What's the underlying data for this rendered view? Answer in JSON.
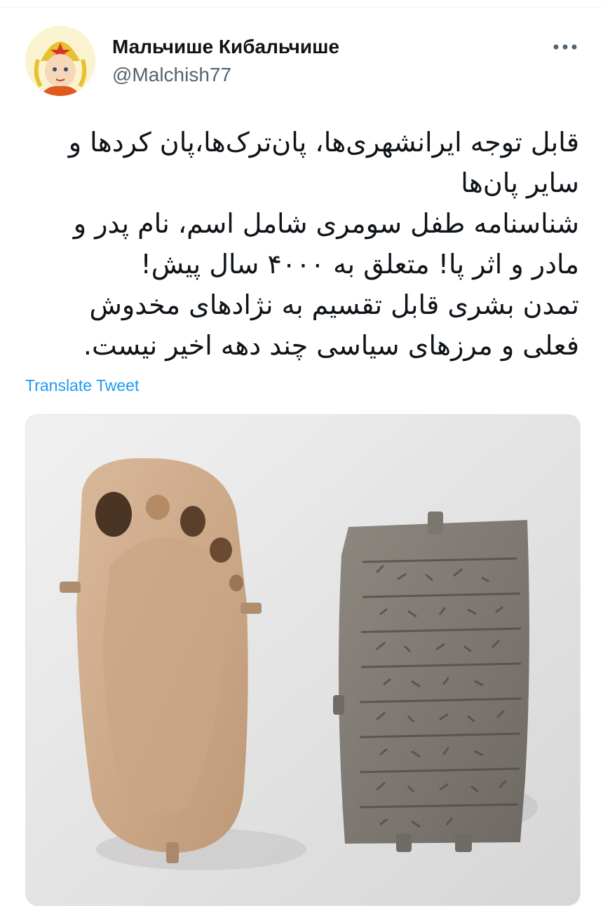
{
  "tweet": {
    "author_name": "Мальчише Кибальчише",
    "author_handle": "@Malchish77",
    "text_lines": [
      "قابل توجه ایرانشهری‌ها، پان‌ترک‌ها،پان کردها و",
      "سایر پان‌ها",
      "شناسنامه طفل سومری شامل اسم، نام پدر و",
      "مادر و اثر پا! متعلق به ۴۰۰۰ سال پیش!",
      "تمدن بشری قابل تقسیم به نژادهای مخدوش",
      "فعلی و مرزهای سیاسی چند دهه اخیر نیست."
    ],
    "translate_label": "Translate Tweet"
  },
  "icons": {
    "more": "more-dots-icon",
    "avatar": "avatar-image"
  },
  "media": {
    "description_objects": [
      "clay-footprint",
      "cuneiform-tablet"
    ]
  },
  "colors": {
    "link": "#1d9bf0",
    "secondary_text": "#536471",
    "primary_text": "#0f1419"
  }
}
